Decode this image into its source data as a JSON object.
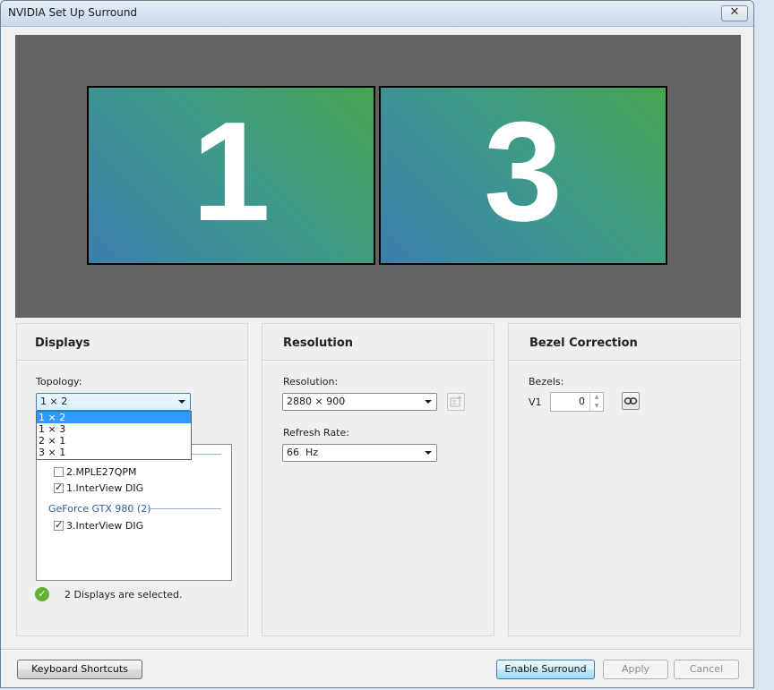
{
  "window": {
    "title": "NVIDIA Set Up Surround",
    "close_symbol": "✕"
  },
  "preview": {
    "monitors": [
      {
        "label": "1"
      },
      {
        "label": "3"
      }
    ]
  },
  "displays_panel": {
    "title": "Displays",
    "topology_label": "Topology:",
    "topology_value": "1 × 2",
    "topology_options": [
      "1 × 2",
      "1 × 3",
      "2 × 1",
      "3 × 1"
    ],
    "selected_option_index": 0,
    "gpu_group": "GeForce GTX 980 (2)",
    "display_items": [
      {
        "label": "2.MPLE27QPM",
        "checked": false
      },
      {
        "label": "1.InterView DIG",
        "checked": true
      },
      {
        "label": "3.InterView DIG",
        "checked": true
      }
    ],
    "status_text": "2 Displays are selected.",
    "status_icon": "check-circle-icon"
  },
  "resolution_panel": {
    "title": "Resolution",
    "resolution_label": "Resolution:",
    "resolution_value": "2880 × 900",
    "refresh_label": "Refresh Rate:",
    "refresh_value": "66  Hz"
  },
  "bezel_panel": {
    "title": "Bezel Correction",
    "bezels_label": "Bezels:",
    "v1_label": "V1",
    "v1_value": "0"
  },
  "footer": {
    "keyboard_shortcuts": "Keyboard Shortcuts",
    "enable_surround": "Enable Surround",
    "apply": "Apply",
    "cancel": "Cancel"
  },
  "colors": {
    "accent": "#3399ff",
    "monitor_gradient_start": "#3a7fae",
    "monitor_gradient_end": "#47a552",
    "preview_bg": "#636363"
  }
}
